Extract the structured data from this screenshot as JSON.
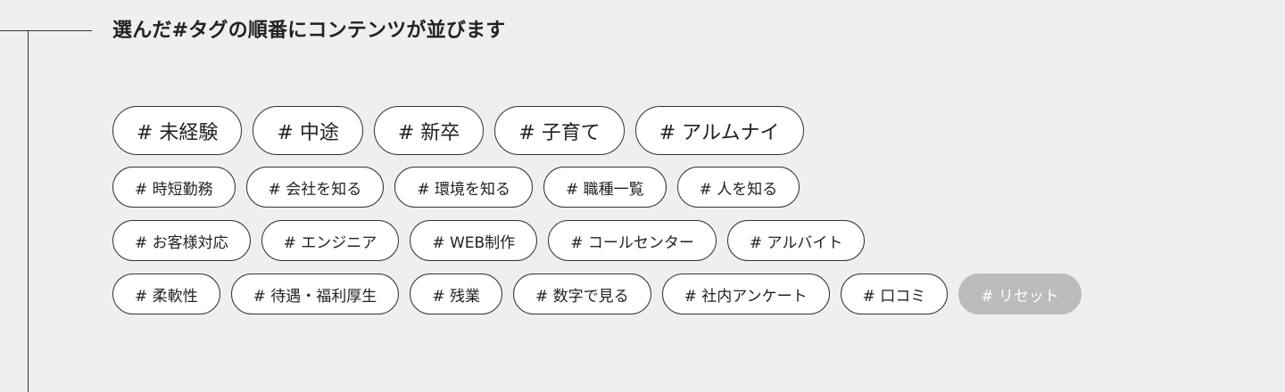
{
  "heading": "選んだ#タグの順番にコンテンツが並びます",
  "tags_primary": [
    "# 未経験",
    "# 中途",
    "# 新卒",
    "# 子育て",
    "# アルムナイ"
  ],
  "tags_row2": [
    "# 時短勤務",
    "# 会社を知る",
    "# 環境を知る",
    "# 職種一覧",
    "# 人を知る"
  ],
  "tags_row3": [
    "# お客様対応",
    "# エンジニア",
    "# WEB制作",
    "# コールセンター",
    "# アルバイト"
  ],
  "tags_row4": [
    "# 柔軟性",
    "# 待遇・福利厚生",
    "# 残業",
    "# 数字で見る",
    "# 社内アンケート",
    "# 口コミ"
  ],
  "reset_label": "# リセット",
  "colors": {
    "background": "#efefef",
    "tag_background": "#ffffff",
    "tag_border": "#333333",
    "reset_background": "#bcbcbc",
    "reset_text": "#ffffff",
    "text": "#222222"
  }
}
